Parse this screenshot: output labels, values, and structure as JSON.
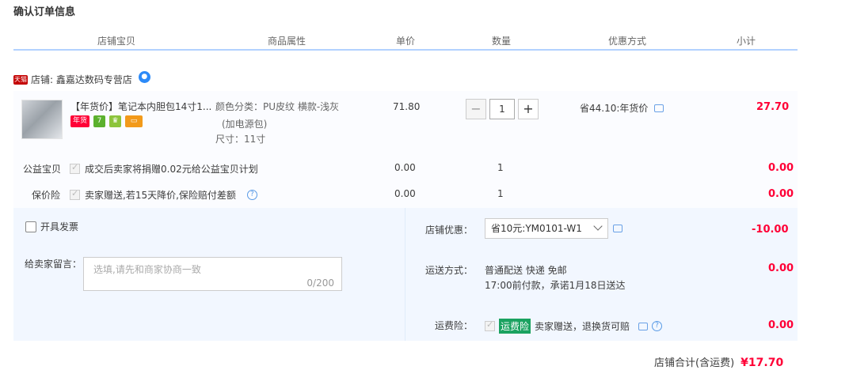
{
  "page_title": "确认订单信息",
  "columns": [
    "店铺宝贝",
    "商品属性",
    "单价",
    "数量",
    "优惠方式",
    "小计"
  ],
  "shop": {
    "badge": "天猫",
    "label": "店铺: 鑫嘉达数码专营店",
    "chat_icon": "wangwang-icon"
  },
  "item": {
    "title": "【年货价】笔记本内胆包14寸1...",
    "attr_color": "颜色分类：PU皮纹 横款-浅灰",
    "attr_color_2": "(加电源包)",
    "attr_size": "尺寸：11寸",
    "price": "71.80",
    "quantity": "1",
    "qty_minus": "−",
    "qty_plus": "+",
    "discount": "省44.10:年货价",
    "subtotal": "27.70",
    "badges": [
      "年货",
      "7",
      "♛",
      "▭"
    ]
  },
  "charity": {
    "label": "公益宝贝",
    "text": "成交后卖家将捐赠0.02元给公益宝贝计划",
    "price": "0.00",
    "quantity": "1",
    "subtotal": "0.00"
  },
  "insurance": {
    "label": "保价险",
    "text": "卖家赠送,若15天降价,保险赔付差额",
    "price": "0.00",
    "quantity": "1",
    "subtotal": "0.00"
  },
  "invoice": {
    "label": "开具发票"
  },
  "message": {
    "label": "给卖家留言：",
    "placeholder": "选填,请先和商家协商一致",
    "counter": "0/200"
  },
  "shop_discount": {
    "label": "店铺优惠：",
    "selected": "省10元:YM0101-W1",
    "amount": "-10.00"
  },
  "shipping": {
    "label": "运送方式：",
    "line1": "普通配送 快递 免邮",
    "line2": "17:00前付款，承诺1月18日送达",
    "amount": "0.00"
  },
  "freight_insurance": {
    "label": "运费险：",
    "tag": "运费险",
    "text": "卖家赠送，退换货可赔",
    "amount": "0.00"
  },
  "total": {
    "label": "店铺合计(含运费)",
    "amount": "¥17.70"
  },
  "colors": {
    "accent_red": "#ff0036",
    "header_border": "#b2d1ff",
    "panel_bg": "#f2f7ff"
  }
}
